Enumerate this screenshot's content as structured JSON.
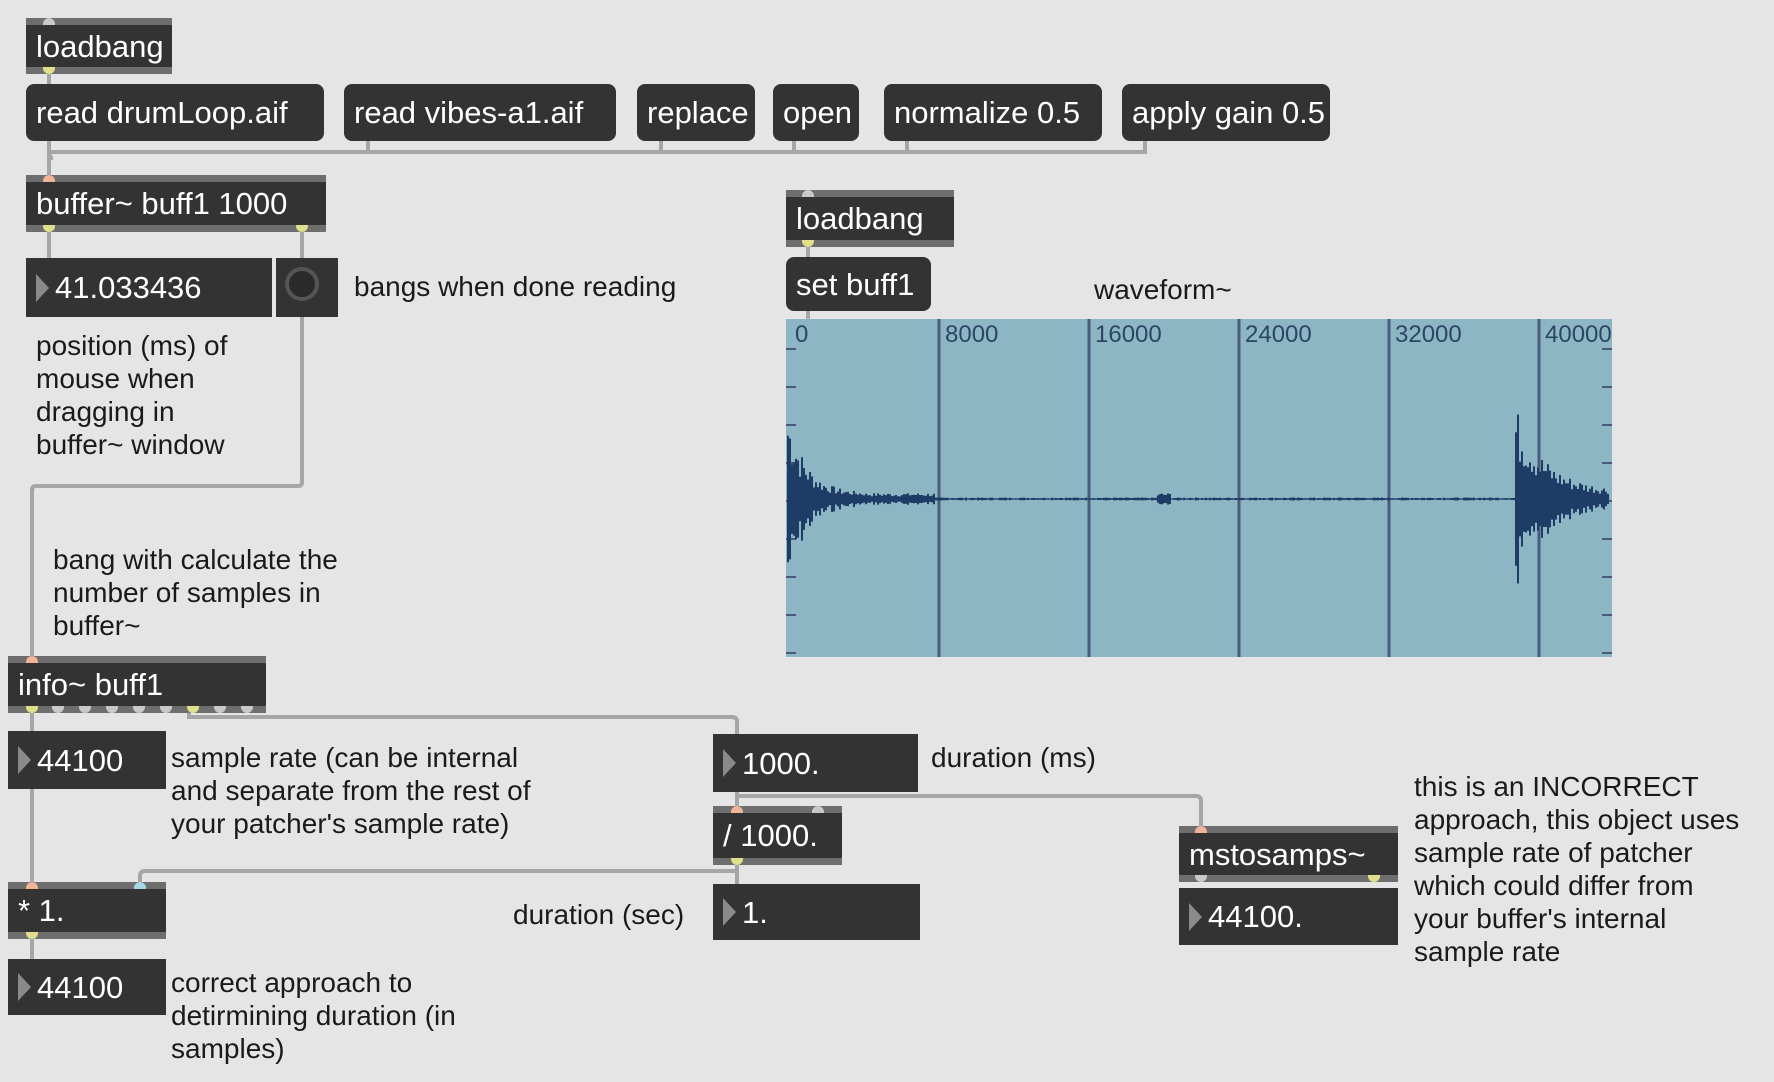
{
  "objects": {
    "loadbang_top": "loadbang",
    "read_drum": "read drumLoop.aif",
    "read_vibes": "read vibes-a1.aif",
    "replace": "replace",
    "open": "open",
    "normalize": "normalize 0.5",
    "apply_gain": "apply gain 0.5",
    "buffer": "buffer~ buff1 1000",
    "position_num": "41.033436",
    "loadbang_wave": "loadbang",
    "set_buff": "set buff1",
    "info": "info~ buff1",
    "sr_num": "44100",
    "dur_ms_num": "1000.",
    "div": "/ 1000.",
    "dur_sec_num": "1.",
    "mult": "* 1.",
    "result_num": "44100",
    "mstosamps": "mstosamps~",
    "mstosamps_num": "44100."
  },
  "comments": {
    "bangs_done": "bangs when done reading",
    "position": [
      "position (ms) of",
      "mouse when",
      "dragging in",
      "buffer~ window"
    ],
    "bang_calc": [
      "bang with calculate the",
      "number of samples in",
      "buffer~"
    ],
    "sample_rate": [
      "sample rate (can be internal",
      "and separate from the rest of",
      "your patcher's sample rate)"
    ],
    "duration_ms": "duration (ms)",
    "duration_sec": "duration (sec)",
    "correct": [
      "correct approach to",
      "detirmining duration (in",
      "samples)"
    ],
    "incorrect": [
      "this is an INCORRECT",
      "approach, this object uses",
      "sample rate of patcher",
      "which could differ from",
      "your buffer's internal",
      "sample rate"
    ],
    "waveform_label": "waveform~"
  },
  "waveform": {
    "ruler_labels": [
      "0",
      "8000",
      "16000",
      "24000",
      "32000",
      "40000"
    ],
    "background": "#8db6c4",
    "wave_color": "#1f3c66",
    "line_color": "#4a5a7a"
  },
  "colors": {
    "object_bg": "#333333",
    "patch_bg": "#e5e5e5",
    "cord": "#a6a6a6"
  }
}
